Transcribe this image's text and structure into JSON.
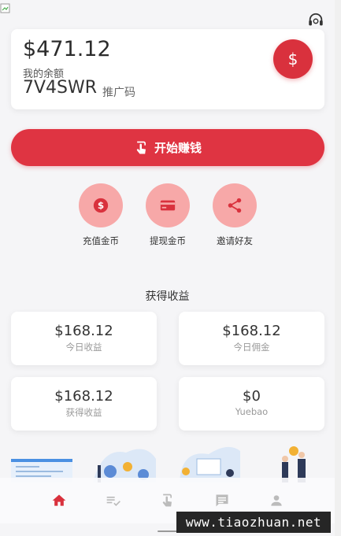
{
  "balance": {
    "amount": "$471.12",
    "label": "我的余额",
    "invite_code": "7V4SWR",
    "invite_label": "推广码",
    "currency_symbol": "$"
  },
  "start_button": {
    "label": "开始赚钱"
  },
  "actions": [
    {
      "label": "充值金币",
      "icon": "coin-icon"
    },
    {
      "label": "提现金币",
      "icon": "card-icon"
    },
    {
      "label": "邀请好友",
      "icon": "share-icon"
    }
  ],
  "earnings": {
    "title": "获得收益",
    "cards": [
      {
        "value": "$168.12",
        "label": "今日收益"
      },
      {
        "value": "$168.12",
        "label": "今日佣金"
      },
      {
        "value": "$168.12",
        "label": "获得收益"
      },
      {
        "value": "$0",
        "label": "Yuebao"
      }
    ]
  },
  "tabbar": [
    {
      "icon": "home-icon",
      "active": true
    },
    {
      "icon": "task-list-icon",
      "active": false
    },
    {
      "icon": "tap-icon",
      "active": false
    },
    {
      "icon": "chat-icon",
      "active": false
    },
    {
      "icon": "person-icon",
      "active": false
    }
  ],
  "watermark": "www.tiaozhuan.net",
  "colors": {
    "primary": "#df3442",
    "action_circle": "#f7a8a8",
    "active_tab": "#d9313d",
    "inactive_tab": "#bbbbbb"
  }
}
